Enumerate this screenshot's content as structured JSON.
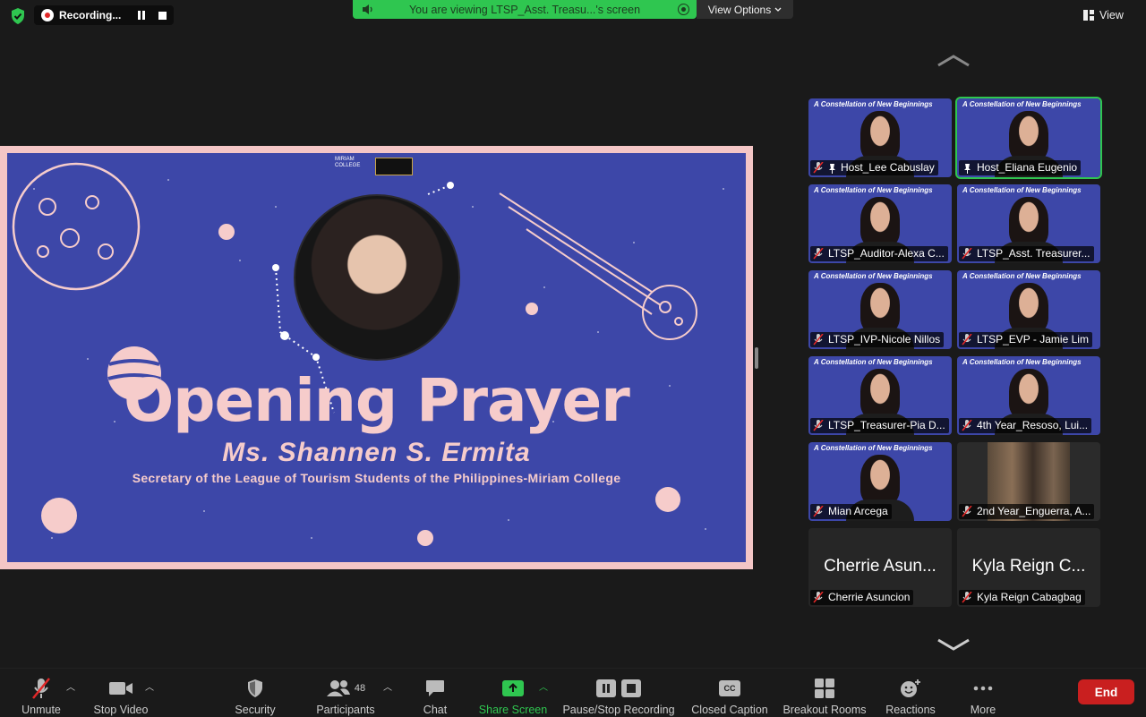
{
  "top_bar": {
    "recording_label": "Recording...",
    "banner_text": "You are viewing LTSP_Asst. Treasu...'s screen",
    "view_options_label": "View Options",
    "view_label": "View"
  },
  "slide": {
    "title": "Opening Prayer",
    "speaker_name": "Ms. Shannen S. Ermita",
    "speaker_role": "Secretary of the League of Tourism Students of the Philippines-Miriam College",
    "logo_text": "MIRIAM COLLEGE"
  },
  "gallery": {
    "tile_background_text": "A Constellation of New Beginnings",
    "participants": [
      {
        "name": "Host_Lee Cabuslay",
        "muted": true,
        "pinned": true,
        "active": false,
        "type": "video"
      },
      {
        "name": "Host_Eliana Eugenio",
        "muted": false,
        "pinned": true,
        "active": true,
        "type": "video"
      },
      {
        "name": "LTSP_Auditor-Alexa C...",
        "muted": true,
        "pinned": false,
        "active": false,
        "type": "video"
      },
      {
        "name": "LTSP_Asst. Treasurer...",
        "muted": true,
        "pinned": false,
        "active": false,
        "type": "video"
      },
      {
        "name": "LTSP_IVP-Nicole Nillos",
        "muted": true,
        "pinned": false,
        "active": false,
        "type": "video"
      },
      {
        "name": "LTSP_EVP - Jamie Lim",
        "muted": true,
        "pinned": false,
        "active": false,
        "type": "video"
      },
      {
        "name": "LTSP_Treasurer-Pia D...",
        "muted": true,
        "pinned": false,
        "active": false,
        "type": "video"
      },
      {
        "name": "4th Year_Resoso, Lui...",
        "muted": true,
        "pinned": false,
        "active": false,
        "type": "video"
      },
      {
        "name": "Mian Arcega",
        "muted": true,
        "pinned": false,
        "active": false,
        "type": "video"
      },
      {
        "name": "2nd Year_Enguerra, A...",
        "muted": true,
        "pinned": false,
        "active": false,
        "type": "photo"
      },
      {
        "name": "Cherrie Asuncion",
        "display_name": "Cherrie Asun...",
        "muted": true,
        "pinned": false,
        "active": false,
        "type": "name"
      },
      {
        "name": "Kyla Reign Cabagbag",
        "display_name": "Kyla Reign C...",
        "muted": true,
        "pinned": false,
        "active": false,
        "type": "name"
      }
    ]
  },
  "toolbar": {
    "unmute": "Unmute",
    "stop_video": "Stop Video",
    "security": "Security",
    "participants": "Participants",
    "participants_count": "48",
    "chat": "Chat",
    "share_screen": "Share Screen",
    "pause_stop_recording": "Pause/Stop Recording",
    "closed_caption": "Closed Caption",
    "breakout_rooms": "Breakout Rooms",
    "reactions": "Reactions",
    "more": "More",
    "end": "End",
    "cc_badge": "CC"
  },
  "colors": {
    "accent_green": "#2fc650",
    "end_red": "#c91f1f",
    "slide_blue": "#3d47a8",
    "slide_pink": "#f6cccb"
  }
}
